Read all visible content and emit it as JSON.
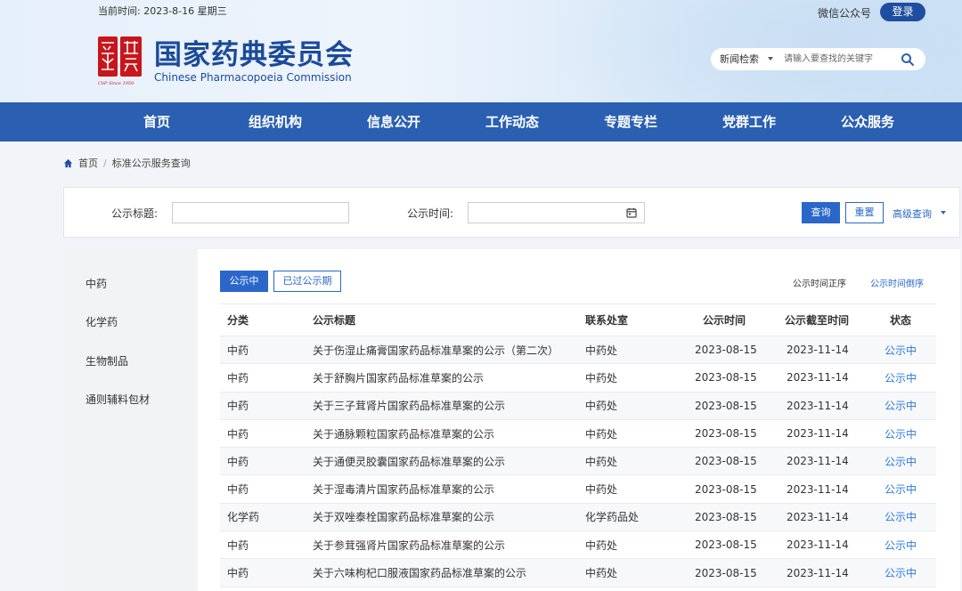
{
  "header": {
    "date": "当前时间: 2023-8-16 星期三",
    "wechat": "微信公众号",
    "login": "登录",
    "brand_cn": "国家药典委员会",
    "brand_en": "Chinese Pharmacopoeia Commission",
    "logo_text": "CbP Since 1950",
    "search_scope": "新闻检索",
    "search_placeholder": "请输入要查找的关键字"
  },
  "nav": [
    "首页",
    "组织机构",
    "信息公开",
    "工作动态",
    "专题专栏",
    "党群工作",
    "公众服务"
  ],
  "breadcrumb": {
    "home": "首页",
    "current": "标准公示服务查询"
  },
  "filter": {
    "title_label": "公示标题:",
    "time_label": "公示时间:",
    "query": "查询",
    "reset": "重置",
    "advanced": "高级查询"
  },
  "sidebar": [
    "中药",
    "化学药",
    "生物制品",
    "通则辅料包材"
  ],
  "tabs": {
    "active": "公示中",
    "other": "已过公示期"
  },
  "sort": {
    "asc": "公示时间正序",
    "desc": "公示时间倒序"
  },
  "table": {
    "headers": [
      "分类",
      "公示标题",
      "联系处室",
      "公示时间",
      "公示截至时间",
      "状态"
    ],
    "rows": [
      {
        "cat": "中药",
        "title": "关于伤湿止痛膏国家药品标准草案的公示（第二次）",
        "dept": "中药处",
        "date": "2023-08-15",
        "end": "2023-11-14",
        "status": "公示中"
      },
      {
        "cat": "中药",
        "title": "关于舒胸片国家药品标准草案的公示",
        "dept": "中药处",
        "date": "2023-08-15",
        "end": "2023-11-14",
        "status": "公示中"
      },
      {
        "cat": "中药",
        "title": "关于三子茸肾片国家药品标准草案的公示",
        "dept": "中药处",
        "date": "2023-08-15",
        "end": "2023-11-14",
        "status": "公示中"
      },
      {
        "cat": "中药",
        "title": "关于通脉颗粒国家药品标准草案的公示",
        "dept": "中药处",
        "date": "2023-08-15",
        "end": "2023-11-14",
        "status": "公示中"
      },
      {
        "cat": "中药",
        "title": "关于通便灵胶囊国家药品标准草案的公示",
        "dept": "中药处",
        "date": "2023-08-15",
        "end": "2023-11-14",
        "status": "公示中"
      },
      {
        "cat": "中药",
        "title": "关于湿毒清片国家药品标准草案的公示",
        "dept": "中药处",
        "date": "2023-08-15",
        "end": "2023-11-14",
        "status": "公示中"
      },
      {
        "cat": "化学药",
        "title": "关于双唑泰栓国家药品标准草案的公示",
        "dept": "化学药品处",
        "date": "2023-08-15",
        "end": "2023-11-14",
        "status": "公示中"
      },
      {
        "cat": "中药",
        "title": "关于参茸强肾片国家药品标准草案的公示",
        "dept": "中药处",
        "date": "2023-08-15",
        "end": "2023-11-14",
        "status": "公示中"
      },
      {
        "cat": "中药",
        "title": "关于六味枸杞口服液国家药品标准草案的公示",
        "dept": "中药处",
        "date": "2023-08-15",
        "end": "2023-11-14",
        "status": "公示中"
      }
    ]
  },
  "colors": {
    "primary": "#2a5fb1",
    "brand": "#1b4a9a",
    "logo_red": "#c8161d",
    "link": "#2a79d8"
  },
  "icons": [
    "search-icon",
    "home-icon",
    "calendar-icon",
    "chevron-down-icon"
  ]
}
